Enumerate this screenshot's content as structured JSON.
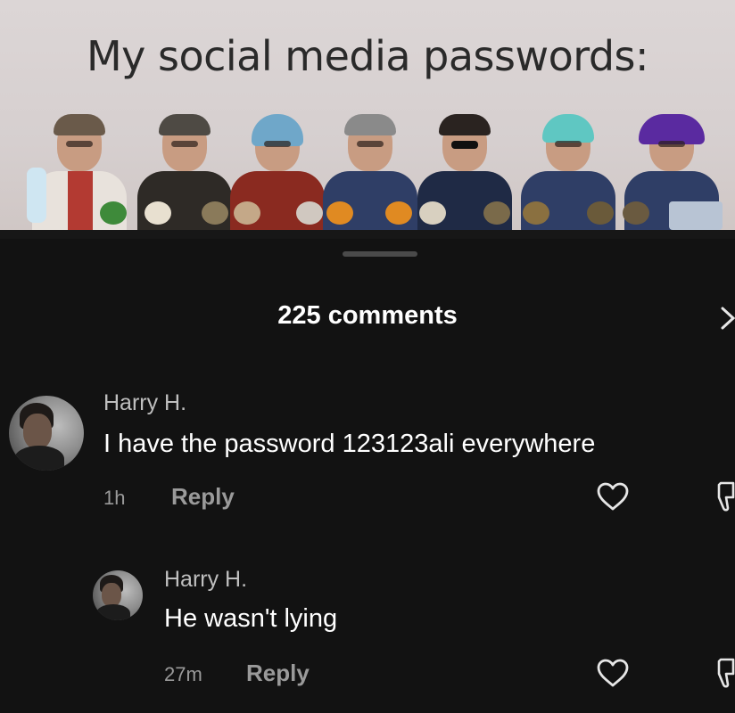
{
  "meme": {
    "title": "My social media passwords:"
  },
  "panel": {
    "comments_count": "225 comments",
    "close_icon": "chevron-right-icon"
  },
  "comments": [
    {
      "author": "Harry H.",
      "text": "I have the password 123123ali everywhere",
      "time": "1h",
      "reply_label": "Reply",
      "icons": [
        "heart-outline-icon",
        "dislike-icon"
      ]
    },
    {
      "author": "Harry H.",
      "text": "He wasn't lying",
      "time": "27m",
      "reply_label": "Reply",
      "icons": [
        "heart-outline-icon",
        "dislike-icon"
      ]
    }
  ],
  "colors": {
    "background": "#121212",
    "primary_text": "#ffffff",
    "secondary_text": "#9a9a9a",
    "author_text": "#bfbfbf"
  }
}
